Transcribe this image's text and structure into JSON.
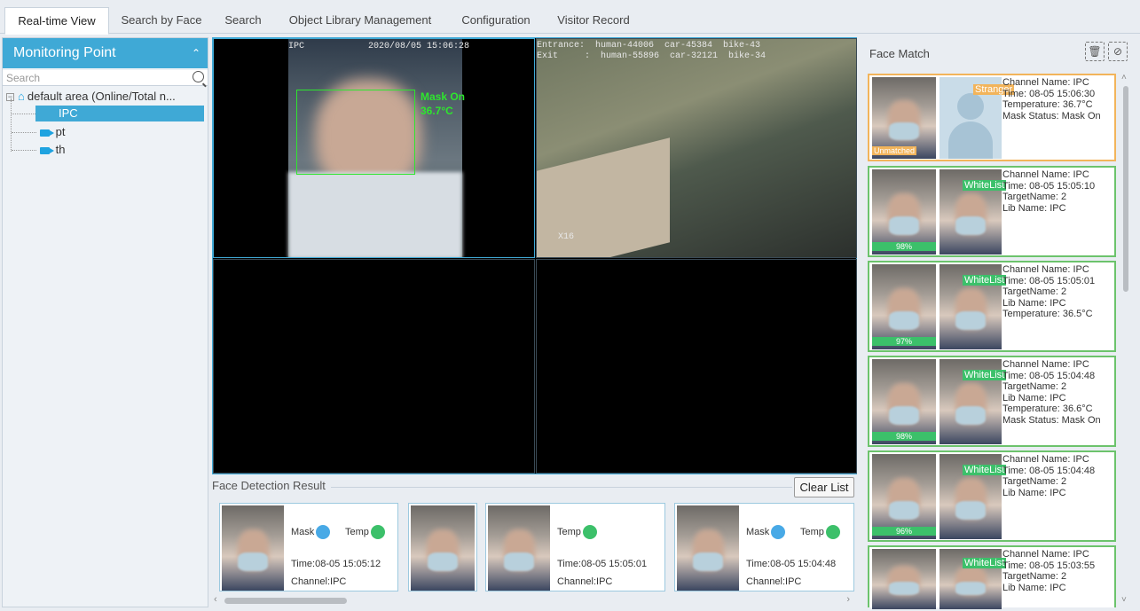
{
  "tabs": [
    {
      "label": "Real-time View",
      "active": true
    },
    {
      "label": "Search by Face"
    },
    {
      "label": "Search"
    },
    {
      "label": "Object Library Management"
    },
    {
      "label": "Configuration"
    },
    {
      "label": "Visitor Record"
    }
  ],
  "left_panel": {
    "title": "Monitoring Point",
    "search_placeholder": "Search",
    "area_label": "default area (Online/Total n...",
    "channels": [
      "IPC",
      "pt",
      "th"
    ]
  },
  "video": {
    "cell1": {
      "name": "IPC",
      "timestamp": "2020/08/05 15:06:28",
      "mask_label": "Mask On",
      "temp_label": "36.7°C"
    },
    "cell2": {
      "line1": "Entrance:  human-44006  car-45384  bike-43",
      "line2": "Exit     :  human-55896  car-32121  bike-34",
      "zoom": "X16"
    }
  },
  "face_detection": {
    "title": "Face Detection Result",
    "clear_button": "Clear List",
    "cards": [
      {
        "mask": "Mask",
        "temp": "Temp",
        "time": "Time:08-05 15:05:12",
        "channel": "Channel:IPC"
      },
      {
        "temp": "Temp",
        "time": "Time:08-05 15:05:01",
        "channel": "Channel:IPC"
      },
      {
        "mask": "Mask",
        "temp": "Temp",
        "time": "Time:08-05 15:04:48",
        "channel": "Channel:IPC"
      }
    ]
  },
  "face_match": {
    "title": "Face Match",
    "items": [
      {
        "type": "stranger",
        "badge": "Stranger",
        "tag": "Unmatched",
        "lines": [
          "Channel Name: IPC",
          "Time: 08-05 15:06:30",
          "Temperature: 36.7°C",
          "Mask Status: Mask On"
        ]
      },
      {
        "type": "whitelist",
        "badge": "WhiteList",
        "score": "98%",
        "lines": [
          "Channel Name: IPC",
          "Time: 08-05 15:05:10",
          "TargetName: 2",
          "Lib Name: IPC"
        ]
      },
      {
        "type": "whitelist",
        "badge": "WhiteList",
        "score": "97%",
        "lines": [
          "Channel Name: IPC",
          "Time: 08-05 15:05:01",
          "TargetName: 2",
          "Lib Name: IPC",
          "Temperature: 36.5°C"
        ]
      },
      {
        "type": "whitelist",
        "badge": "WhiteList",
        "score": "98%",
        "lines": [
          "Channel Name: IPC",
          "Time: 08-05 15:04:48",
          "TargetName: 2",
          "Lib Name: IPC",
          "Temperature: 36.6°C",
          "Mask Status: Mask On"
        ]
      },
      {
        "type": "whitelist",
        "badge": "WhiteList",
        "score": "96%",
        "lines": [
          "Channel Name: IPC",
          "Time: 08-05 15:04:48",
          "TargetName: 2",
          "Lib Name: IPC"
        ]
      },
      {
        "type": "whitelist",
        "badge": "WhiteList",
        "score": "",
        "lines": [
          "Channel Name: IPC",
          "Time: 08-05 15:03:55",
          "TargetName: 2",
          "Lib Name: IPC"
        ]
      }
    ]
  },
  "colors": {
    "accent": "#3fa9d6",
    "whitelist": "#3cc06a",
    "stranger": "#f2b45b"
  }
}
